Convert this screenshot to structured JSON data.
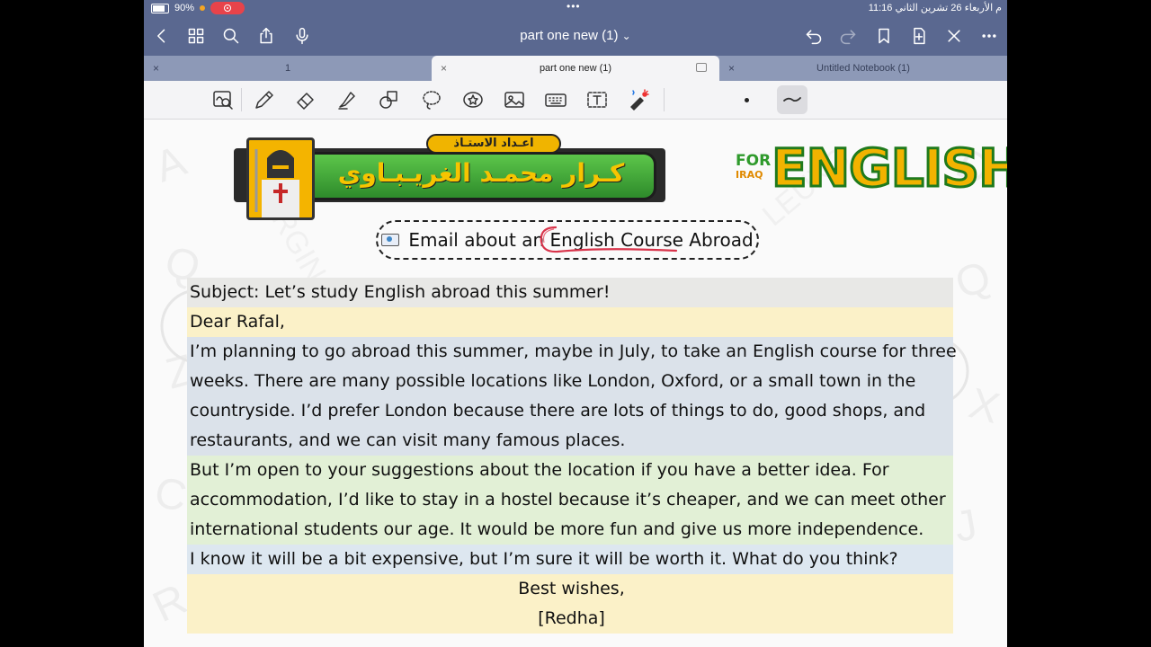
{
  "status_bar": {
    "battery": "90%",
    "time_date": "11:16 م  الأربعاء 26 تشرين الثاني",
    "dots": "•••"
  },
  "nav": {
    "title": "part one new (1)",
    "title_chevron": "⌄"
  },
  "tabs": [
    {
      "label": "1",
      "close": "×"
    },
    {
      "label": "part one new (1)",
      "close": "×"
    },
    {
      "label": "Untitled Notebook (1)",
      "close": "×"
    }
  ],
  "header": {
    "author_pill": "اعـداد الاستـاذ",
    "author_name": "كـرار محمـد الغريـبـاوي",
    "logo_for": "FOR",
    "logo_iraq": "IRAQ",
    "logo_english": "ENGLISH"
  },
  "title": "Email about an English Course Abroad",
  "letter": {
    "subject": "Subject: Let’s study English abroad this summer!",
    "greeting": "Dear Rafal,",
    "p1": [
      "I’m planning to go abroad this summer, maybe in July, to take an English course for three",
      "weeks. There are many possible locations like London, Oxford, or a small town in the",
      "countryside. I’d prefer London because there are lots of things to do, good shops, and",
      "restaurants, and we can visit many famous places."
    ],
    "p2": [
      "But I’m open to your suggestions about the location if you have a better idea. For",
      "accommodation, I’d like to stay in a hostel because it’s cheaper, and we can meet other",
      "international students our age. It would be more fun and give us more independence."
    ],
    "p3": "I know it will be a bit expensive, but I’m sure it will be worth it. What do you think?",
    "closing": "Best wishes,",
    "signature": "[Redha]"
  }
}
